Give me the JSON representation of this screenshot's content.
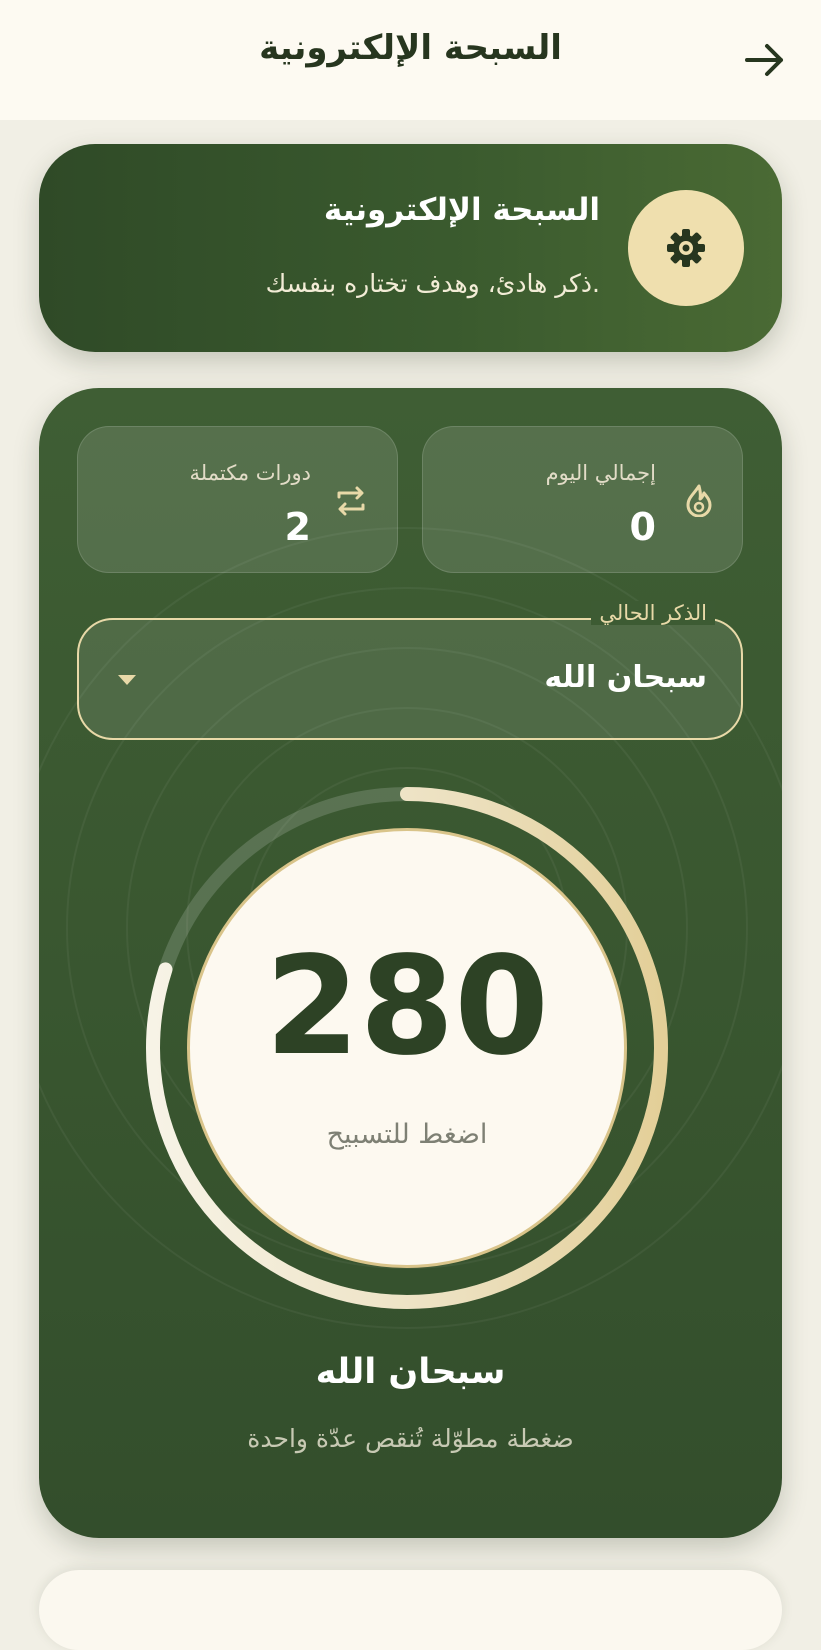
{
  "appbar": {
    "title": "السبحة الإلكترونية",
    "back_icon": "arrow-right-icon"
  },
  "header": {
    "title": "السبحة الإلكترونية",
    "subtitle": "ذكر هادئ، وهدف تختاره بنفسك.",
    "settings_icon": "gear-icon"
  },
  "stats": {
    "today_label": "إجمالي اليوم",
    "today_value": "0",
    "today_icon": "flame-icon",
    "rounds_label": "دورات مكتملة",
    "rounds_value": "2",
    "rounds_icon": "repeat-icon"
  },
  "dhikr_select": {
    "label": "الذكر الحالي",
    "value": "سبحان الله",
    "arrow_icon": "dropdown-arrow-icon"
  },
  "counter": {
    "count": "280",
    "hint": "اضغط للتسبيح",
    "progress_fraction": 0.8
  },
  "footer": {
    "dhikr_name": "سبحان الله",
    "long_press_hint": "ضغطة مطوّلة تُنقص عدّة واحدة"
  },
  "colors": {
    "primary_green": "#3a5a2e",
    "accent_gold": "#efdfae",
    "cream": "#fdf9f0",
    "count_text": "#2d4225"
  }
}
